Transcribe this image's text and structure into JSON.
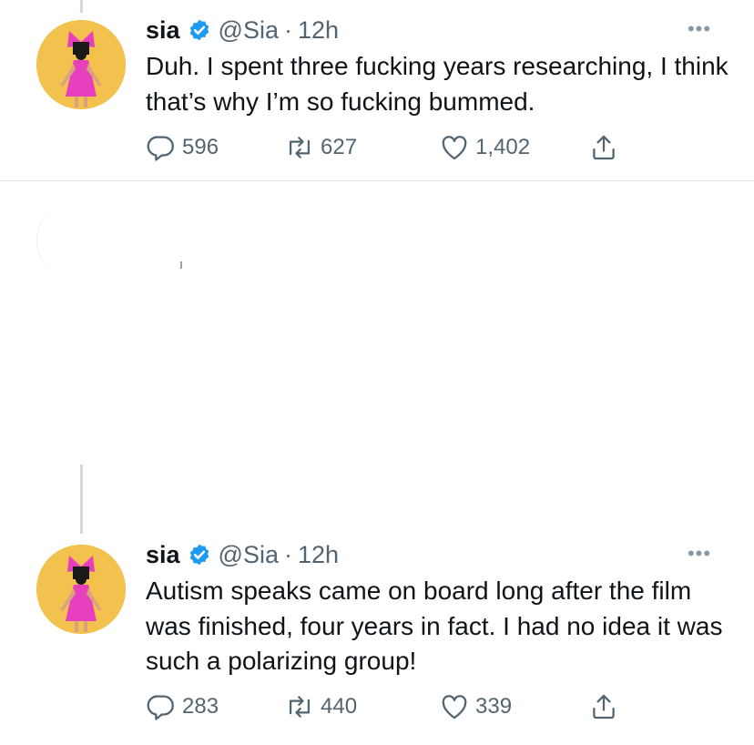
{
  "tweets": [
    {
      "author": {
        "name": "sia",
        "handle": "@Sia",
        "verified_icon": "verified-badge-icon",
        "avatar_icon": "avatar-pink-dress-bow"
      },
      "separator": "·",
      "time": "12h",
      "more_icon": "ellipsis-icon",
      "more_label": "•••",
      "text": "Duh. I spent three fucking years researching, I think that’s why I’m so fucking bummed.",
      "actions": {
        "reply": {
          "icon": "reply-icon",
          "count": "596"
        },
        "retweet": {
          "icon": "retweet-icon",
          "count": "627"
        },
        "like": {
          "icon": "like-icon",
          "count": "1,402"
        },
        "share": {
          "icon": "share-icon"
        }
      }
    },
    {
      "author": {
        "name": "sia",
        "handle": "@Sia",
        "verified_icon": "verified-badge-icon",
        "avatar_icon": "avatar-pink-dress-bow"
      },
      "separator": "·",
      "time": "12h",
      "more_icon": "ellipsis-icon",
      "more_label": "•••",
      "text": "Autism speaks came on  board long after the film was finished, four years in fact. I had no idea it was such a polarizing group!",
      "actions": {
        "reply": {
          "icon": "reply-icon",
          "count": "283"
        },
        "retweet": {
          "icon": "retweet-icon",
          "count": "440"
        },
        "like": {
          "icon": "like-icon",
          "count": "339"
        },
        "share": {
          "icon": "share-icon"
        }
      }
    }
  ],
  "colors": {
    "text_primary": "#0f1419",
    "text_secondary": "#536471",
    "verified_blue": "#1d9bf0",
    "avatar_bg": "#f2c14e",
    "dress_pink": "#e83fbe",
    "divider": "#e1e6ea",
    "thread_line": "#cfd9de"
  }
}
